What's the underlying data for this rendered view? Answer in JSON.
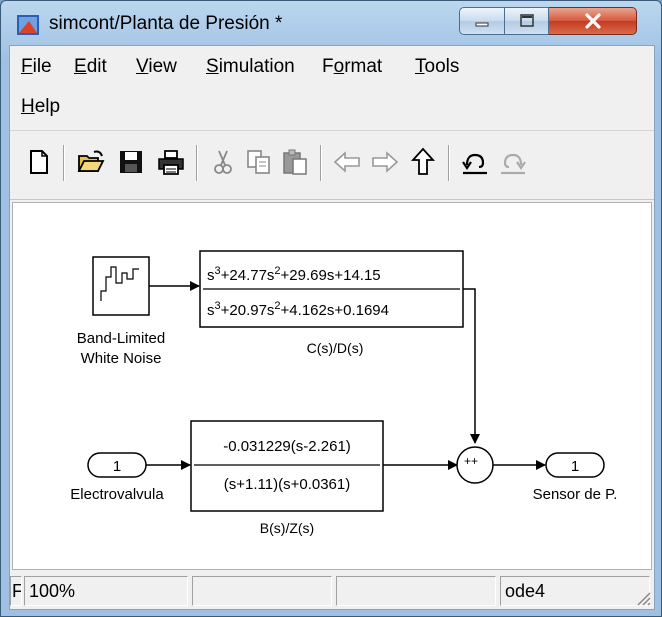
{
  "window": {
    "title": "simcont/Planta de Presión *",
    "close_label": "X"
  },
  "menu": {
    "file": "File",
    "file_key": "F",
    "file_rest": "ile",
    "edit_key": "E",
    "edit_rest": "dit",
    "view_key": "V",
    "view_rest": "iew",
    "simulation_key": "S",
    "simulation_rest": "imulation",
    "format_pre": "F",
    "format_key": "o",
    "format_rest": "rmat",
    "tools_key": "T",
    "tools_rest": "ools",
    "help_key": "H",
    "help_rest": "elp"
  },
  "toolbar": {
    "icons": [
      "new-file-icon",
      "open-folder-icon",
      "save-icon",
      "print-icon",
      "cut-icon",
      "copy-icon",
      "paste-icon",
      "back-arrow-icon",
      "forward-arrow-icon",
      "up-arrow-icon",
      "undo-icon",
      "redo-icon"
    ]
  },
  "diagram": {
    "noise_block_label_1": "Band-Limited",
    "noise_block_label_2": "White Noise",
    "tf1_numerator": "s3+24.77s2+29.69s+14.15",
    "tf1_num_parts": [
      "s",
      "3",
      "+24.77s",
      "2",
      "+29.69s+14.15"
    ],
    "tf1_den_parts": [
      "s",
      "3",
      "+20.97s",
      "2",
      "+4.162s+0.1694"
    ],
    "tf1_caption": "C(s)/D(s)",
    "inport_number": "1",
    "inport_label": "Electrovalvula",
    "tf2_numerator": "-0.031229(s-2.261)",
    "tf2_denominator": "(s+1.11)(s+0.0361)",
    "tf2_caption": "B(s)/Z(s)",
    "sum_signs": "++",
    "outport_number": "1",
    "outport_label": "Sensor de P."
  },
  "status": {
    "first": "F",
    "zoom": "100%",
    "cell3": "",
    "cell4": "",
    "solver": "ode4"
  }
}
